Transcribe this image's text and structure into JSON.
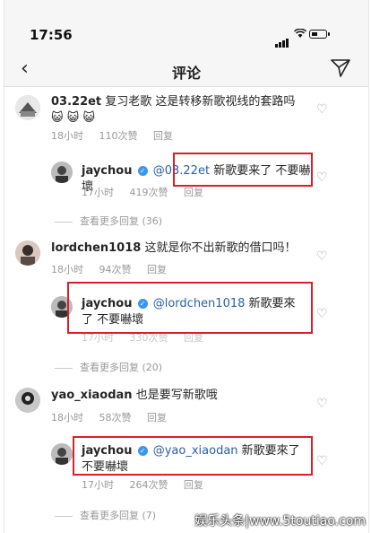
{
  "status": {
    "time": "17:56"
  },
  "nav": {
    "title": "评论"
  },
  "comments": [
    {
      "user": "03.22et",
      "text": "复习老歌 这是转移新歌视线的套路吗",
      "emoji": "😺 😺 😺",
      "time": "18小时",
      "likes": "110次赞",
      "reply": "回复",
      "replyItem": {
        "user": "jaychou",
        "mention": "@03.22et",
        "text": "新歌要来了 不要嚇壞",
        "time": "17小时",
        "likes": "419次赞",
        "reply": "回复"
      },
      "viewMore": "查看更多回复 (36)"
    },
    {
      "user": "lordchen1018",
      "text": "这就是你不出新歌的借口吗！",
      "time": "18小时",
      "likes": "94次赞",
      "reply": "回复",
      "replyItem": {
        "user": "jaychou",
        "mention": "@lordchen1018",
        "text": "新歌要來了 不要嚇壞",
        "time": "17小时",
        "likes": "330次赞",
        "reply": "回复"
      },
      "viewMore": "查看更多回复 (20)"
    },
    {
      "user": "yao_xiaodan",
      "text": "也是要写新歌哦",
      "time": "18小时",
      "likes": "58次赞",
      "reply": "回复",
      "replyItem": {
        "user": "jaychou",
        "mention": "@yao_xiaodan",
        "text": "新歌要來了 不要嚇壞",
        "time": "17小时",
        "likes": "264次赞",
        "reply": "回复"
      },
      "viewMore": "查看更多回复 (7)"
    }
  ],
  "watermark": "娱乐头条|www.5toutiao.com",
  "colors": {
    "highlight": "#d8202c",
    "mention": "#2a5fa8",
    "verified": "#3897f0"
  }
}
